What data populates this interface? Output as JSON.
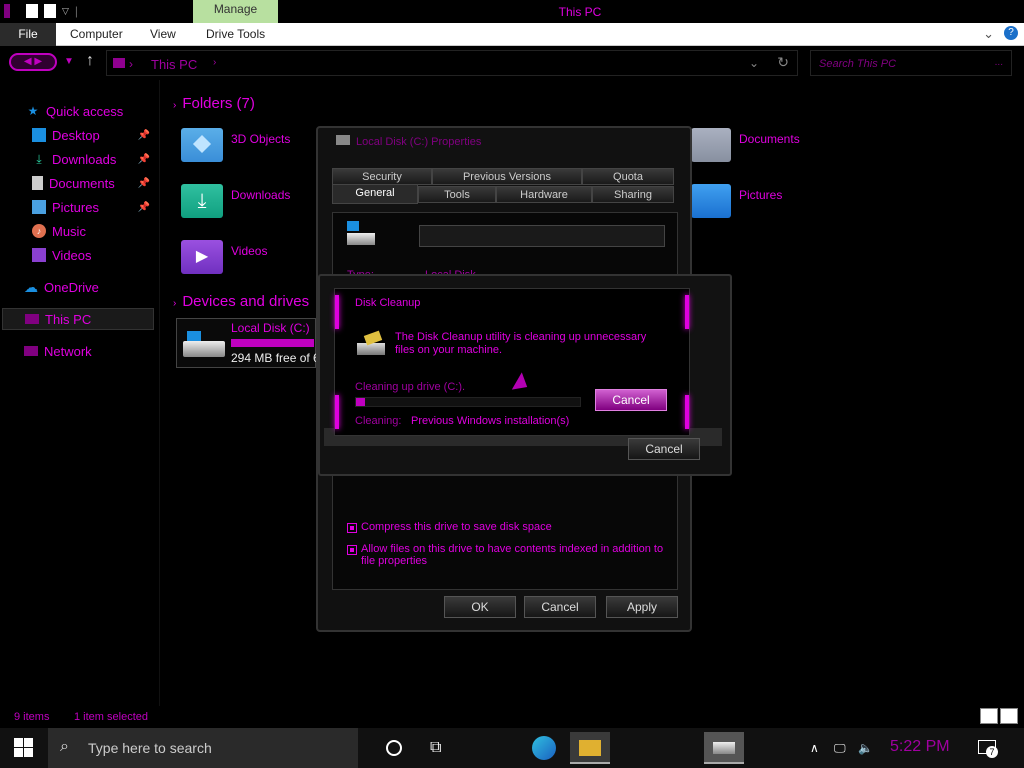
{
  "window": {
    "title": "This PC",
    "context_tab": "Manage"
  },
  "ribbon": {
    "tabs": [
      "File",
      "Computer",
      "View",
      "Drive Tools"
    ]
  },
  "address": {
    "path": "This PC",
    "search_placeholder": "Search This PC"
  },
  "sidebar": {
    "items": [
      {
        "label": "Quick access",
        "icon": "star-icon"
      },
      {
        "label": "Desktop",
        "icon": "desktop-icon",
        "pinned": true
      },
      {
        "label": "Downloads",
        "icon": "download-icon",
        "pinned": true
      },
      {
        "label": "Documents",
        "icon": "document-icon",
        "pinned": true
      },
      {
        "label": "Pictures",
        "icon": "pictures-icon",
        "pinned": true
      },
      {
        "label": "Music",
        "icon": "music-icon"
      },
      {
        "label": "Videos",
        "icon": "videos-icon"
      },
      {
        "label": "OneDrive",
        "icon": "cloud-icon"
      },
      {
        "label": "This PC",
        "icon": "computer-icon",
        "selected": true
      },
      {
        "label": "Network",
        "icon": "network-icon"
      }
    ]
  },
  "main": {
    "folders_heading": "Folders (7)",
    "devices_heading": "Devices and drives",
    "folders": [
      "3D Objects",
      "Downloads",
      "Videos",
      "Documents",
      "Pictures"
    ],
    "drive": {
      "name": "Local Disk (C:)",
      "free_text": "294 MB free of 6",
      "used_fraction": 0.97
    }
  },
  "properties_dialog": {
    "title": "Local Disk (C:) Properties",
    "tabs_row1": [
      "Security",
      "Previous Versions",
      "Quota"
    ],
    "tabs_row2": [
      "General",
      "Tools",
      "Hardware",
      "Sharing"
    ],
    "type_label": "Type:",
    "type_value": "Local Disk",
    "compress_label": "Compress this drive to save disk space",
    "index_label": "Allow files on this drive to have contents indexed in addition to file properties",
    "ok": "OK",
    "cancel": "Cancel",
    "apply": "Apply",
    "cancel_behind": "Cancel"
  },
  "disk_cleanup": {
    "title": "Disk Cleanup",
    "message": "The Disk Cleanup utility is cleaning up unnecessary files on your machine.",
    "cleaning_drive_label": "Cleaning up drive  (C:).",
    "progress_fraction": 0.04,
    "cleaning_label": "Cleaning:",
    "cleaning_value": "Previous Windows installation(s)",
    "cancel": "Cancel"
  },
  "statusbar": {
    "items": "9 items",
    "selected": "1 item selected"
  },
  "taskbar": {
    "search_placeholder": "Type here to search",
    "clock": "5:22 PM",
    "notification_count": "7"
  },
  "colors": {
    "accent": "#e000e0",
    "background": "#000000",
    "manage_tab": "#b8e0a0"
  }
}
